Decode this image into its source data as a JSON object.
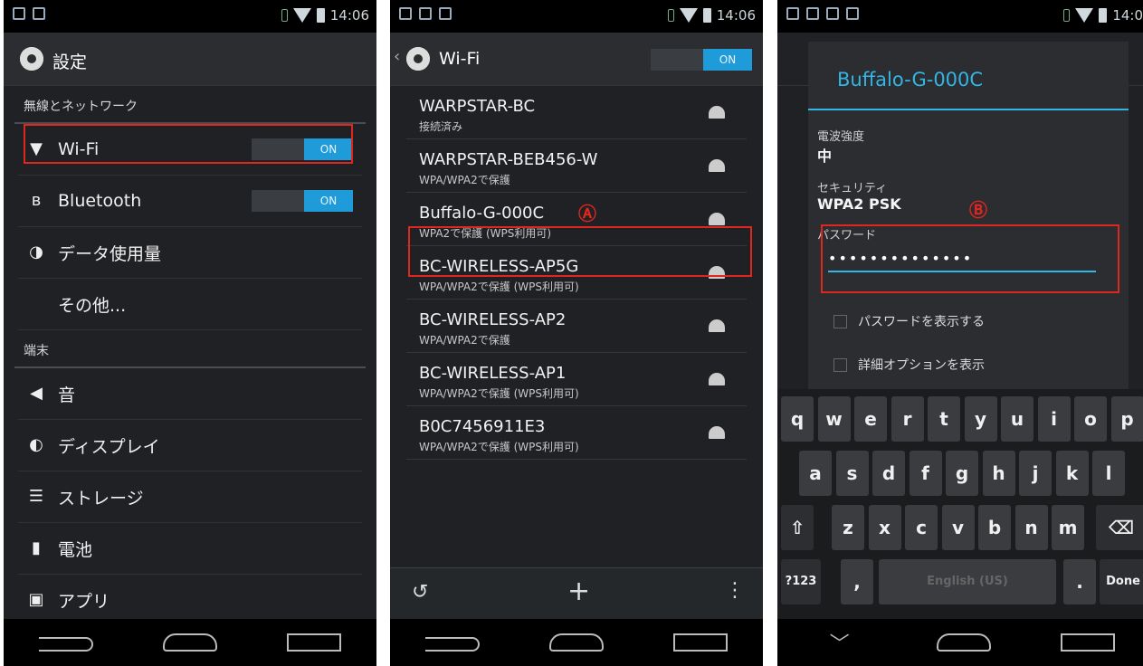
{
  "status": {
    "time": "14:06"
  },
  "p1": {
    "title": "設定",
    "section1": "無線とネットワーク",
    "wifi_label": "Wi-Fi",
    "wifi_toggle": "ON",
    "bt_label": "Bluetooth",
    "bt_toggle": "ON",
    "data_label": "データ使用量",
    "other_label": "その他...",
    "section2": "端末",
    "sound_label": "音",
    "display_label": "ディスプレイ",
    "storage_label": "ストレージ",
    "battery_label": "電池",
    "apps_label": "アプリ"
  },
  "p2": {
    "title": "Wi-Fi",
    "toggle": "ON",
    "annotation": "Ⓐ",
    "networks": [
      {
        "ssid": "WARPSTAR-BC",
        "sub": "接続済み"
      },
      {
        "ssid": "WARPSTAR-BEB456-W",
        "sub": "WPA/WPA2で保護"
      },
      {
        "ssid": "Buffalo-G-000C",
        "sub": "WPA2で保護 (WPS利用可)"
      },
      {
        "ssid": "BC-WIRELESS-AP5G",
        "sub": "WPA/WPA2で保護 (WPS利用可)"
      },
      {
        "ssid": "BC-WIRELESS-AP2",
        "sub": "WPA/WPA2で保護"
      },
      {
        "ssid": "BC-WIRELESS-AP1",
        "sub": "WPA/WPA2で保護 (WPS利用可)"
      },
      {
        "ssid": "B0C7456911E3",
        "sub": "WPA/WPA2で保護 (WPS利用可)"
      }
    ]
  },
  "p3": {
    "dialog_title": "Buffalo-G-000C",
    "strength_label": "電波強度",
    "strength_value": "中",
    "security_label": "セキュリティ",
    "security_value": "WPA2 PSK",
    "annotation": "Ⓑ",
    "password_label": "パスワード",
    "password_value": "••••••••••••••",
    "show_password": "パスワードを表示する",
    "advanced": "詳細オプションを表示",
    "time": "14:0",
    "keys_row1": [
      "q",
      "w",
      "e",
      "r",
      "t",
      "y",
      "u",
      "i",
      "o",
      "p"
    ],
    "keys_row2": [
      "a",
      "s",
      "d",
      "f",
      "g",
      "h",
      "j",
      "k",
      "l"
    ],
    "keys_row3": [
      "z",
      "x",
      "c",
      "v",
      "b",
      "n",
      "m"
    ],
    "key_123": "?123",
    "key_comma": ",",
    "key_space": "English (US)",
    "key_period": ".",
    "key_done": "Done"
  }
}
